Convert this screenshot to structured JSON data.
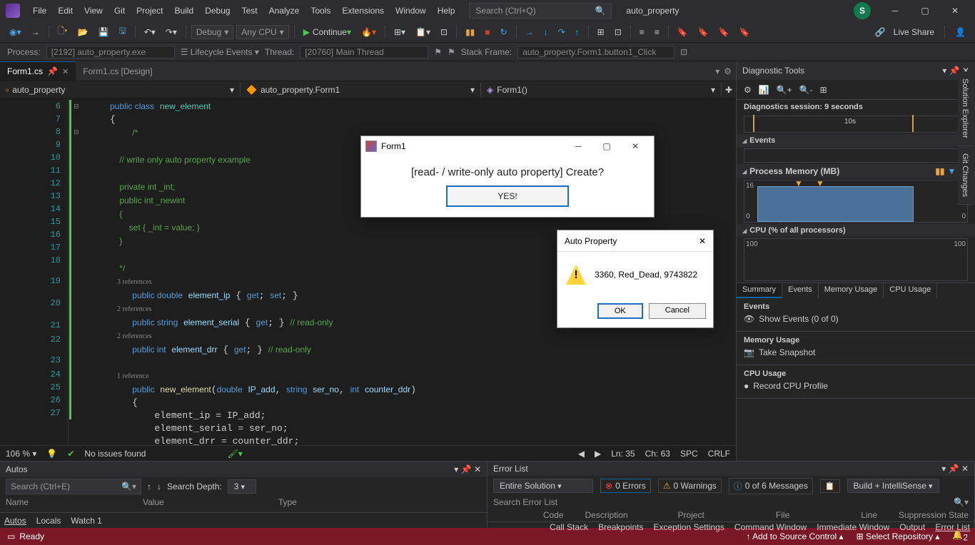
{
  "menu": [
    "File",
    "Edit",
    "View",
    "Git",
    "Project",
    "Build",
    "Debug",
    "Test",
    "Analyze",
    "Tools",
    "Extensions",
    "Window",
    "Help"
  ],
  "search_placeholder": "Search (Ctrl+Q)",
  "project_name": "auto_property",
  "avatar": "S",
  "toolbar": {
    "config": "Debug",
    "platform": "Any CPU",
    "continue": "Continue",
    "live_share": "Live Share"
  },
  "debug_bar": {
    "process_l": "Process:",
    "process": "[2192] auto_property.exe",
    "lifecycle": "Lifecycle Events",
    "thread_l": "Thread:",
    "thread": "[20760] Main Thread",
    "stack_l": "Stack Frame:",
    "stack": "auto_property.Form1.button1_Click"
  },
  "tabs": [
    {
      "name": "Form1.cs",
      "pin": "📌",
      "active": true
    },
    {
      "name": "Form1.cs [Design]",
      "active": false
    }
  ],
  "nav": {
    "ns": "auto_property",
    "class": "auto_property.Form1",
    "method": "Form1()"
  },
  "lines": [
    6,
    7,
    8,
    9,
    10,
    11,
    12,
    13,
    14,
    15,
    16,
    17,
    18,
    19,
    20,
    21,
    22,
    23,
    24,
    25,
    26,
    27
  ],
  "code": {
    "l6": "public class new_element",
    "l7": "{",
    "l8": "    /*",
    "l9": "",
    "l10": "    // write only auto property example",
    "l11": "",
    "l12": "    private int _int;",
    "l13": "    public int _newint",
    "l14": "    {",
    "l15": "        set { _int = value; }",
    "l16": "    }",
    "l17": "",
    "l18": "    */",
    "r3": "    3 references",
    "l19": "    public double element_ip { get; set; }",
    "r2a": "    2 references",
    "l20": "    public string element_serial { get; } // read-only",
    "r2b": "    2 references",
    "l21": "    public int element_drr { get; } // read-only",
    "l22": "",
    "r1": "    1 reference",
    "l23": "    public new_element(double IP_add, string ser_no, int counter_ddr)",
    "l24": "    {",
    "l25": "        element_ip = IP_add;",
    "l26": "        element_serial = ser_no;",
    "l27": "        element_drr = counter_ddr;"
  },
  "status": {
    "zoom": "106 %",
    "issues": "No issues found",
    "ln": "Ln: 35",
    "ch": "Ch: 63",
    "ins": "SPC",
    "crlf": "CRLF"
  },
  "diag": {
    "title": "Diagnostic Tools",
    "session": "Diagnostics session: 9 seconds",
    "timeline": "10s",
    "events": "Events",
    "mem_title": "Process Memory (MB)",
    "mem_max": "16",
    "mem_min": "0",
    "cpu_title": "CPU (% of all processors)",
    "cpu_max": "100",
    "cpu_min": "0",
    "tabs": [
      "Summary",
      "Events",
      "Memory Usage",
      "CPU Usage"
    ],
    "ev_hdr": "Events",
    "ev_show": "Show Events (0 of 0)",
    "mu_hdr": "Memory Usage",
    "mu_snap": "Take Snapshot",
    "cu_hdr": "CPU Usage",
    "cu_rec": "Record CPU Profile"
  },
  "side_tabs": [
    "Solution Explorer",
    "Git Changes"
  ],
  "autos": {
    "title": "Autos",
    "search": "Search (Ctrl+E)",
    "depth": "Search Depth:",
    "depth_v": "3",
    "cols": [
      "Name",
      "Value",
      "Type"
    ],
    "tabs": [
      "Autos",
      "Locals",
      "Watch 1"
    ]
  },
  "errlist": {
    "title": "Error List",
    "scope": "Entire Solution",
    "errors": "0 Errors",
    "warnings": "0 Warnings",
    "messages": "0 of 6 Messages",
    "build": "Build + IntelliSense",
    "search": "Search Error List",
    "cols": [
      "Code",
      "Description",
      "Project",
      "File",
      "Line",
      "Suppression State"
    ],
    "tabs": [
      "Call Stack",
      "Breakpoints",
      "Exception Settings",
      "Command Window",
      "Immediate Window",
      "Output",
      "Error List"
    ]
  },
  "footer": {
    "ready": "Ready",
    "add_src": "Add to Source Control",
    "repo": "Select Repository",
    "bell": "2"
  },
  "form1": {
    "title": "Form1",
    "question": "[read- / write-only auto property] Create?",
    "yes": "YES!"
  },
  "autoprop": {
    "title": "Auto Property",
    "msg": "3360, Red_Dead, 9743822",
    "ok": "OK",
    "cancel": "Cancel"
  }
}
